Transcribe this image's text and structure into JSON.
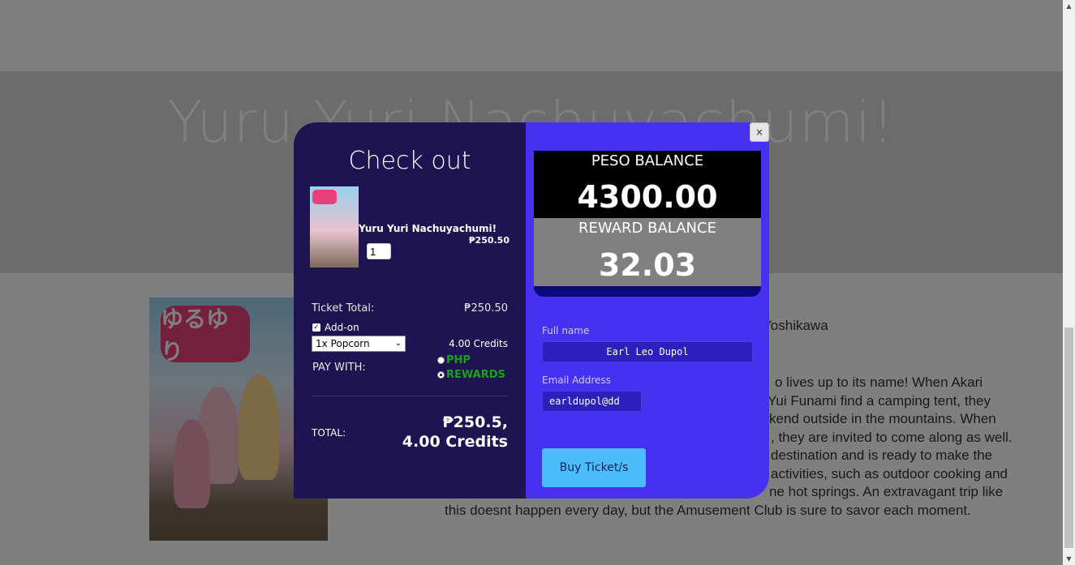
{
  "page": {
    "hero_title": "Yuru Yuri Nachuyachumi!",
    "director_fragment": "Yoshikawa",
    "synopsis_lines": [
      "o lives up to its name! When Akari",
      "Yui Funami find a camping tent, they",
      "kend outside in the mountains. When",
      ", they are invited to come along as well.",
      "destination and is ready to make the",
      "activities, such as outdoor cooking and",
      "ne hot springs. An extravagant trip like",
      "this doesnt happen every day, but the Amusement Club is sure to savor each moment."
    ]
  },
  "modal": {
    "close_label": "×",
    "title": "Check out",
    "movie": {
      "name": "Yuru Yuri Nachuyachumi!",
      "price": "₱250.50",
      "quantity": "1"
    },
    "ticket_total_label": "Ticket Total:",
    "ticket_total_value": "₱250.50",
    "addon_label": "Add-on",
    "addon_checked": true,
    "addon_selected": "1x Popcorn",
    "addon_credits": "4.00 Credits",
    "pay_with_label": "PAY WITH:",
    "pay_options": [
      {
        "label": "PHP",
        "selected": false
      },
      {
        "label": "REWARDS",
        "selected": true
      }
    ],
    "total_label": "TOTAL:",
    "total_value_line1": "₱250.5,",
    "total_value_line2": "4.00 Credits",
    "balances": {
      "peso_label": "PESO BALANCE",
      "peso_value": "4300.00",
      "reward_label": "REWARD BALANCE",
      "reward_value": "32.03"
    },
    "form": {
      "fullname_label": "Full name",
      "fullname_value": "Earl Leo Dupol",
      "email_label": "Email Address",
      "email_value": "earldupol@dd"
    },
    "buy_button": "Buy Ticket/s"
  },
  "colors": {
    "modal_left_bg": "#1e1452",
    "modal_right_bg": "#4631f0",
    "buy_button_bg": "#4cbdfc",
    "radio_text": "#1d9e1d"
  }
}
